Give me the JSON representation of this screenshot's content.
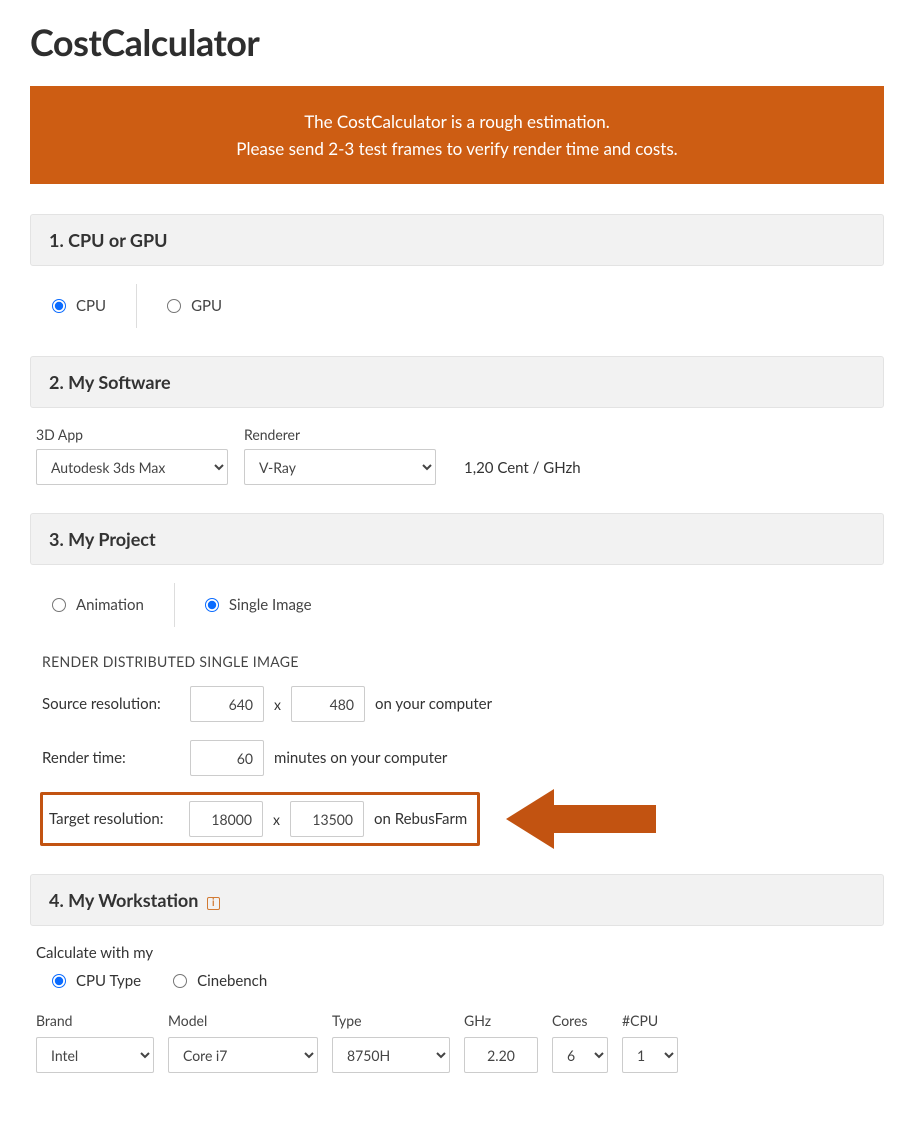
{
  "title": "CostCalculator",
  "notice": {
    "line1": "The CostCalculator is a rough estimation.",
    "line2": "Please send 2-3 test frames to verify render time and costs."
  },
  "section1": {
    "header": "1. CPU or GPU",
    "cpu_label": "CPU",
    "gpu_label": "GPU",
    "selected": "cpu"
  },
  "section2": {
    "header": "2. My Software",
    "app_label": "3D App",
    "app_value": "Autodesk 3ds Max",
    "renderer_label": "Renderer",
    "renderer_value": "V-Ray",
    "price_text": "1,20 Cent / GHzh"
  },
  "section3": {
    "header": "3. My Project",
    "animation_label": "Animation",
    "single_label": "Single Image",
    "selected": "single",
    "subhead": "RENDER DISTRIBUTED SINGLE IMAGE",
    "source_label": "Source resolution:",
    "source_w": "640",
    "source_h": "480",
    "source_suffix": "on your computer",
    "time_label": "Render time:",
    "time_value": "60",
    "time_suffix": "minutes on your computer",
    "target_label": "Target resolution:",
    "target_w": "18000",
    "target_h": "13500",
    "target_suffix": "on RebusFarm",
    "x_sep": "x"
  },
  "section4": {
    "header": "4. My Workstation",
    "calc_with": "Calculate with my",
    "cputype_label": "CPU Type",
    "cinebench_label": "Cinebench",
    "selected": "cputype",
    "brand_label": "Brand",
    "brand_value": "Intel",
    "model_label": "Model",
    "model_value": "Core i7",
    "type_label": "Type",
    "type_value": "8750H",
    "ghz_label": "GHz",
    "ghz_value": "2.20",
    "cores_label": "Cores",
    "cores_value": "6",
    "ncpu_label": "#CPU",
    "ncpu_value": "1"
  }
}
